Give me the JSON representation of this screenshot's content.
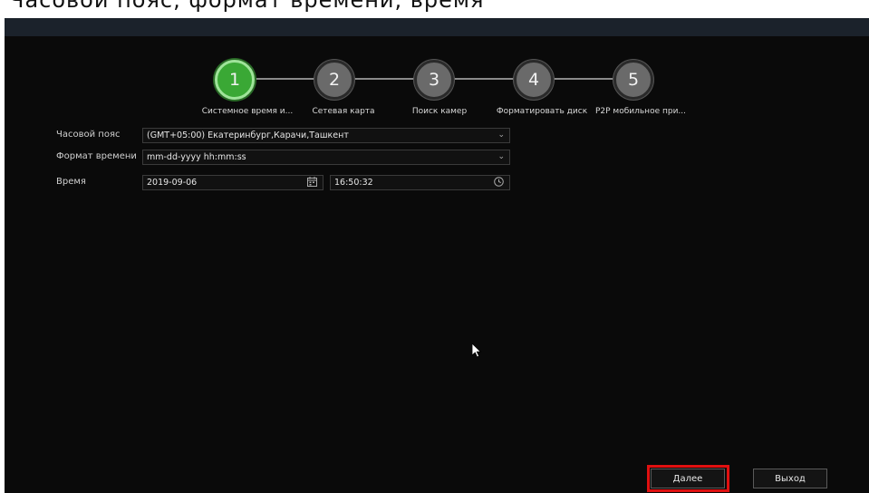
{
  "clipped_heading": "Часовой пояс, формат времени, время",
  "steps": [
    {
      "number": "1",
      "label": "Системное время и...",
      "active": true
    },
    {
      "number": "2",
      "label": "Сетевая карта",
      "active": false
    },
    {
      "number": "3",
      "label": "Поиск камер",
      "active": false
    },
    {
      "number": "4",
      "label": "Форматировать диск",
      "active": false
    },
    {
      "number": "5",
      "label": "P2P мобильное при...",
      "active": false
    }
  ],
  "form": {
    "timezone_label": "Часовой пояс",
    "timezone_value": "(GMT+05:00) Екатеринбург,Карачи,Ташкент",
    "time_format_label": "Формат времени",
    "time_format_value": "mm-dd-yyyy hh:mm:ss",
    "time_label": "Время",
    "date_value": "2019-09-06",
    "time_value": "16:50:32"
  },
  "buttons": {
    "next_label": "Далее",
    "exit_label": "Выход"
  },
  "colors": {
    "active_step": "#3aa835",
    "inactive_step": "#6a6a6a",
    "highlight": "#e01010",
    "background": "#0a0a0a"
  }
}
